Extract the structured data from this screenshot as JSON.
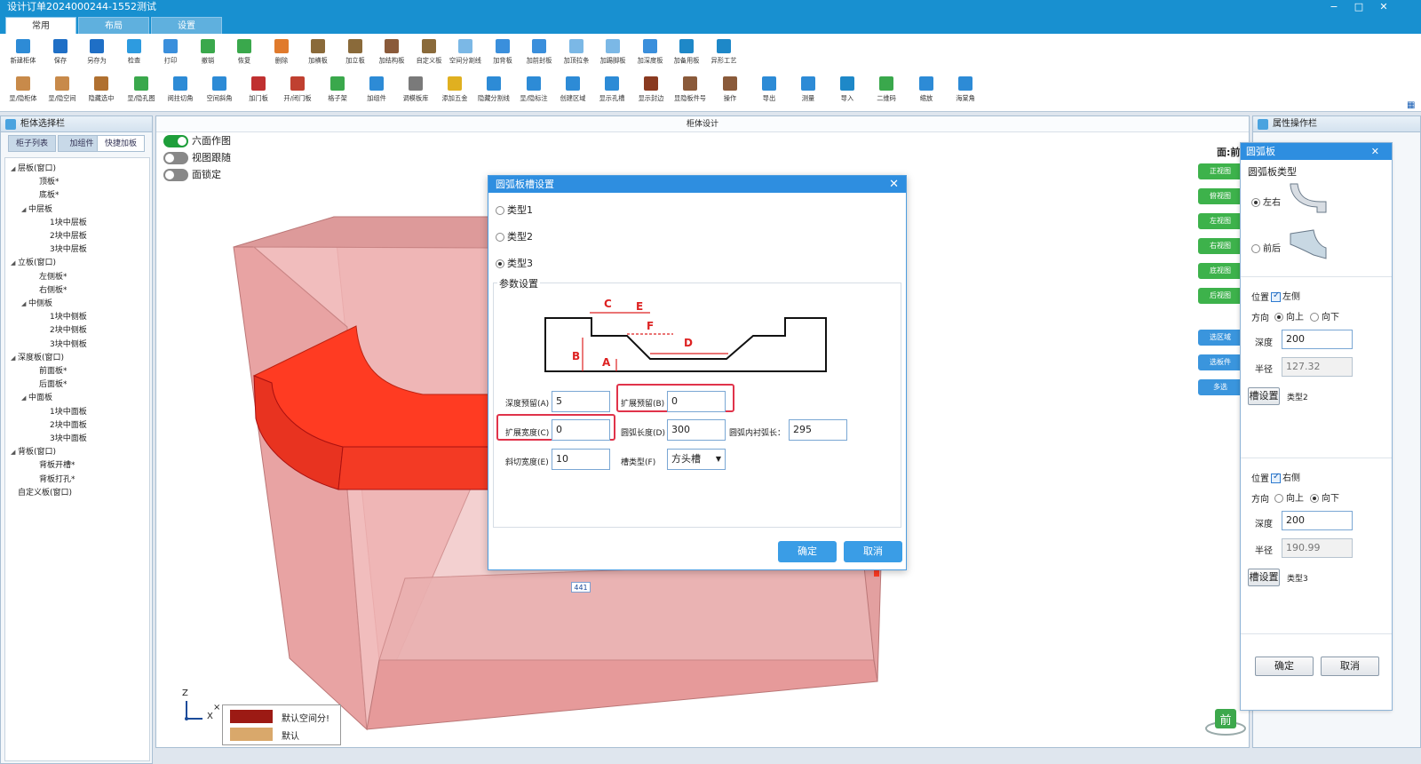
{
  "window": {
    "title": "设计订单2024000244-1552测试",
    "controls": [
      "−",
      "□",
      "✕"
    ]
  },
  "ribbon": {
    "tabs": [
      "常用",
      "布局",
      "设置"
    ],
    "active_tab": "常用",
    "row1": [
      {
        "label": "新建柜体",
        "icon": "new-cabinet-icon",
        "color": "#2d8bd6"
      },
      {
        "label": "保存",
        "icon": "save-icon",
        "color": "#1f6fc6"
      },
      {
        "label": "另存为",
        "icon": "save-as-icon",
        "color": "#1f6fc6"
      },
      {
        "label": "检查",
        "icon": "check-icon",
        "color": "#2d9be0"
      },
      {
        "label": "打印",
        "icon": "print-icon",
        "color": "#3a8fdc"
      },
      {
        "label": "撤销",
        "icon": "undo-icon",
        "color": "#3aa84c"
      },
      {
        "label": "恢复",
        "icon": "redo-icon",
        "color": "#3aa84c"
      },
      {
        "label": "删除",
        "icon": "delete-icon",
        "color": "#e07a2c"
      },
      {
        "label": "加横板",
        "icon": "add-horizontal-board-icon",
        "color": "#8a6a3a"
      },
      {
        "label": "加立板",
        "icon": "add-vertical-board-icon",
        "color": "#8a6a3a"
      },
      {
        "label": "加结构板",
        "icon": "add-structure-board-icon",
        "color": "#8a5a3a"
      },
      {
        "label": "自定义板",
        "icon": "custom-board-icon",
        "color": "#8a6a3a"
      },
      {
        "label": "空间分割线",
        "icon": "space-divider-icon",
        "color": "#7bb8e6"
      },
      {
        "label": "加背板",
        "icon": "add-back-board-icon",
        "color": "#3a8fdc"
      },
      {
        "label": "加前封板",
        "icon": "add-front-seal-icon",
        "color": "#3a8fdc"
      },
      {
        "label": "加顶拉条",
        "icon": "add-top-strip-icon",
        "color": "#7bb8e6"
      },
      {
        "label": "加踢脚板",
        "icon": "add-kick-board-icon",
        "color": "#7bb8e6"
      },
      {
        "label": "加深度板",
        "icon": "add-depth-board-icon",
        "color": "#3a8fdc"
      },
      {
        "label": "加备用板",
        "icon": "add-spare-board-icon",
        "color": "#1e88c8"
      },
      {
        "label": "异形工艺",
        "icon": "special-process-icon",
        "color": "#1e88c8"
      }
    ],
    "row2": [
      {
        "label": "显/隐柜体",
        "icon": "toggle-cabinet-icon",
        "color": "#c88a4a"
      },
      {
        "label": "显/隐空间",
        "icon": "toggle-space-icon",
        "color": "#c88a4a"
      },
      {
        "label": "隐藏选中",
        "icon": "hide-selected-icon",
        "color": "#b07030"
      },
      {
        "label": "显/隐孔图",
        "icon": "toggle-hole-icon",
        "color": "#3aa84c"
      },
      {
        "label": "阅拄切角",
        "icon": "corner-cut-icon",
        "color": "#2d8bd6"
      },
      {
        "label": "空间斜角",
        "icon": "space-bevel-icon",
        "color": "#2d8bd6"
      },
      {
        "label": "加门板",
        "icon": "add-door-icon",
        "color": "#c03030"
      },
      {
        "label": "开/闭门板",
        "icon": "open-close-door-icon",
        "color": "#c04030"
      },
      {
        "label": "格子架",
        "icon": "grid-rack-icon",
        "color": "#3aa84c"
      },
      {
        "label": "加组件",
        "icon": "add-component-icon",
        "color": "#2d8bd6"
      },
      {
        "label": "调模板库",
        "icon": "template-library-icon",
        "color": "#7a7a7a"
      },
      {
        "label": "添加五金",
        "icon": "add-hardware-icon",
        "color": "#e0b020"
      },
      {
        "label": "隐藏分割线",
        "icon": "hide-divider-icon",
        "color": "#2d8bd6"
      },
      {
        "label": "显/隐标注",
        "icon": "toggle-dimension-icon",
        "color": "#2d8bd6"
      },
      {
        "label": "创建区域",
        "icon": "create-region-icon",
        "color": "#2d8bd6"
      },
      {
        "label": "显示孔槽",
        "icon": "show-slot-icon",
        "color": "#2d8bd6"
      },
      {
        "label": "显示封边",
        "icon": "show-edge-icon",
        "color": "#8a3a20"
      },
      {
        "label": "显隐板件号",
        "icon": "toggle-part-number-icon",
        "color": "#8a5a3a"
      },
      {
        "label": "操作",
        "icon": "operate-icon",
        "color": "#8a5a3a"
      },
      {
        "label": "导出",
        "icon": "export-icon",
        "color": "#2d8bd6"
      },
      {
        "label": "测量",
        "icon": "measure-icon",
        "color": "#2d8bd6"
      },
      {
        "label": "导入",
        "icon": "import-icon",
        "color": "#1e88c8"
      },
      {
        "label": "二维码",
        "icon": "qr-code-icon",
        "color": "#3aa84c"
      },
      {
        "label": "缩放",
        "icon": "zoom-icon",
        "color": "#2d8bd6"
      },
      {
        "label": "海棠角",
        "icon": "begonia-corner-icon",
        "color": "#2d8bd6"
      }
    ]
  },
  "left_panel": {
    "title": "柜体选择栏",
    "tabs": [
      "柜子列表",
      "加组件",
      "快捷加板"
    ],
    "active_tab": "快捷加板",
    "tree": [
      {
        "label": "层板(窗口)",
        "level": 0,
        "toggle": "◢"
      },
      {
        "label": "顶板*",
        "level": 2,
        "toggle": ""
      },
      {
        "label": "底板*",
        "level": 2,
        "toggle": ""
      },
      {
        "label": "中层板",
        "level": 1,
        "toggle": "◢"
      },
      {
        "label": "1块中层板",
        "level": 3,
        "toggle": ""
      },
      {
        "label": "2块中层板",
        "level": 3,
        "toggle": ""
      },
      {
        "label": "3块中层板",
        "level": 3,
        "toggle": ""
      },
      {
        "label": "立板(窗口)",
        "level": 0,
        "toggle": "◢"
      },
      {
        "label": "左侧板*",
        "level": 2,
        "toggle": ""
      },
      {
        "label": "右侧板*",
        "level": 2,
        "toggle": ""
      },
      {
        "label": "中侧板",
        "level": 1,
        "toggle": "◢"
      },
      {
        "label": "1块中侧板",
        "level": 3,
        "toggle": ""
      },
      {
        "label": "2块中侧板",
        "level": 3,
        "toggle": ""
      },
      {
        "label": "3块中侧板",
        "level": 3,
        "toggle": ""
      },
      {
        "label": "深度板(窗口)",
        "level": 0,
        "toggle": "◢"
      },
      {
        "label": "前面板*",
        "level": 2,
        "toggle": ""
      },
      {
        "label": "后面板*",
        "level": 2,
        "toggle": ""
      },
      {
        "label": "中面板",
        "level": 1,
        "toggle": "◢"
      },
      {
        "label": "1块中面板",
        "level": 3,
        "toggle": ""
      },
      {
        "label": "2块中面板",
        "level": 3,
        "toggle": ""
      },
      {
        "label": "3块中面板",
        "level": 3,
        "toggle": ""
      },
      {
        "label": "背板(窗口)",
        "level": 0,
        "toggle": "◢"
      },
      {
        "label": "背板开槽*",
        "level": 2,
        "toggle": ""
      },
      {
        "label": "背板打孔*",
        "level": 2,
        "toggle": ""
      },
      {
        "label": "自定义板(窗口)",
        "level": 0,
        "toggle": ""
      }
    ]
  },
  "design_area": {
    "title": "柜体设计",
    "toggles": [
      {
        "label": "六面作图",
        "on": true
      },
      {
        "label": "视图跟随",
        "on": false
      },
      {
        "label": "面锁定",
        "on": false
      }
    ],
    "face_label": "面:前",
    "view_buttons": [
      "正视图",
      "俯视图",
      "左视图",
      "右视图",
      "底视图",
      "后视图"
    ],
    "action_buttons": [
      "选区域",
      "选板件",
      "多选"
    ],
    "dimension_badge": "441",
    "legend": [
      {
        "label": "默认空间分!",
        "color": "#9c1a14"
      },
      {
        "label": "默认",
        "color": "#d9a86b"
      }
    ],
    "axis_z": "Z",
    "axis_x": "X",
    "front_icon_label": "前"
  },
  "dialog": {
    "title": "圆弧板槽设置",
    "close": "✕",
    "types": [
      {
        "label": "类型1",
        "checked": false
      },
      {
        "label": "类型2",
        "checked": false
      },
      {
        "label": "类型3",
        "checked": true
      }
    ],
    "param_title": "参数设置",
    "diagram_labels": {
      "A": "A",
      "B": "B",
      "C": "C",
      "D": "D",
      "E": "E",
      "F": "F"
    },
    "fields": {
      "depth_reserve": {
        "label": "深度预留(A)",
        "value": "5"
      },
      "expand_reserve": {
        "label": "扩展预留(B)",
        "value": "0"
      },
      "expand_width": {
        "label": "扩展宽度(C)",
        "value": "0"
      },
      "arc_length": {
        "label": "圆弧长度(D)",
        "value": "300"
      },
      "arc_inner_chord": {
        "label": "圆弧内衬弧长：",
        "value": "295"
      },
      "bevel_width": {
        "label": "斜切宽度(E)",
        "value": "10"
      },
      "slot_type": {
        "label": "槽类型(F)",
        "value": "方头槽"
      }
    },
    "ok": "确定",
    "cancel": "取消"
  },
  "right_panel": {
    "title": "属性操作栏",
    "sub_title": "圆弧板",
    "sub_close": "✕",
    "type_label": "圆弧板类型",
    "type_options": [
      {
        "label": "左右",
        "checked": true
      },
      {
        "label": "前后",
        "checked": false
      }
    ],
    "group1": {
      "position_label": "位置",
      "position_value": "左侧",
      "direction_label": "方向",
      "dir_up": "向上",
      "dir_down": "向下",
      "dir_selected": "up",
      "depth_label": "深度",
      "depth_value": "200",
      "radius_label": "半径",
      "radius_value": "127.32",
      "slot_btn": "槽设置",
      "slot_type": "类型2"
    },
    "group2": {
      "position_label": "位置",
      "position_value": "右侧",
      "direction_label": "方向",
      "dir_up": "向上",
      "dir_down": "向下",
      "dir_selected": "down",
      "depth_label": "深度",
      "depth_value": "200",
      "radius_label": "半径",
      "radius_value": "190.99",
      "slot_btn": "槽设置",
      "slot_type": "类型3"
    },
    "ok": "确定",
    "cancel": "取消"
  }
}
